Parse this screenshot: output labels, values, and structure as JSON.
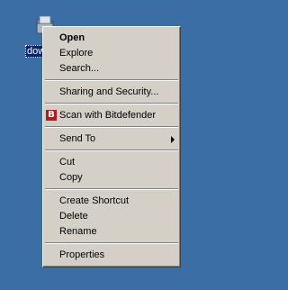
{
  "desktop": {
    "icon_label": "dow",
    "icon_name": "folder-icon"
  },
  "menu": {
    "items": [
      {
        "label": "Open"
      },
      {
        "label": "Explore"
      },
      {
        "label": "Search..."
      },
      {
        "label": "Sharing and Security..."
      },
      {
        "label": "Scan with Bitdefender",
        "icon": "bitdefender-icon",
        "icon_text": "B"
      },
      {
        "label": "Send To",
        "submenu": "chevron-right-icon"
      },
      {
        "label": "Cut"
      },
      {
        "label": "Copy"
      },
      {
        "label": "Create Shortcut"
      },
      {
        "label": "Delete"
      },
      {
        "label": "Rename"
      },
      {
        "label": "Properties"
      }
    ]
  },
  "colors": {
    "desktop_background": "#3a6ea5",
    "menu_background": "#d4d0c8",
    "selection": "#0a246a",
    "bitdefender_red": "#b01c1c"
  }
}
